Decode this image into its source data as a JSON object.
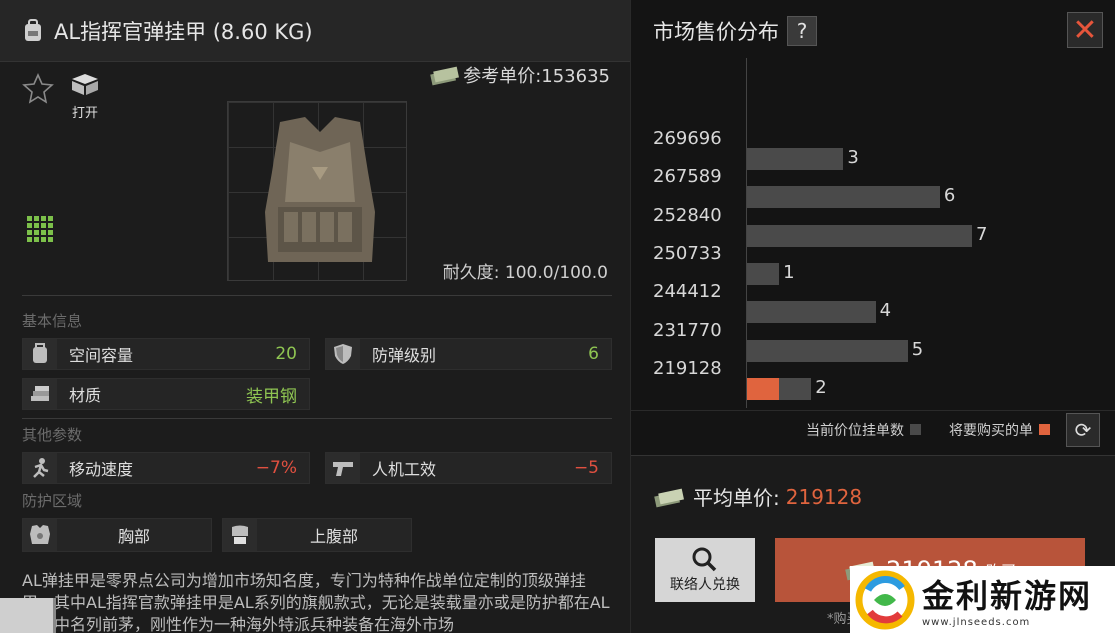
{
  "item": {
    "title": "AL指挥官弹挂甲 (8.60 KG)",
    "open_label": "打开",
    "ref_price_label": "参考单价:153635",
    "durability": "耐久度: 100.0/100.0"
  },
  "basic_info": {
    "section_label": "基本信息",
    "capacity_label": "空间容量",
    "capacity_value": "20",
    "armor_class_label": "防弹级别",
    "armor_class_value": "6",
    "material_label": "材质",
    "material_value": "装甲钢"
  },
  "other_params": {
    "section_label": "其他参数",
    "move_speed_label": "移动速度",
    "move_speed_value": "−7%",
    "ergonomics_label": "人机工效",
    "ergonomics_value": "−5"
  },
  "protection": {
    "section_label": "防护区域",
    "zones": [
      "胸部",
      "上腹部"
    ]
  },
  "description": "AL弹挂甲是零界点公司为增加市场知名度，专门为特种作战单位定制的顶级弹挂甲。其中AL指挥官款弹挂甲是AL系列的旗舰款式，无论是装载量亦或是防护都在AL系列中名列前茅，刚性作为一种海外特派兵种装备在海外市场",
  "market": {
    "title": "市场售价分布",
    "help_label": "?",
    "close_label": "✕",
    "legend_current": "当前价位挂单数",
    "legend_buy": "将要购买的单",
    "refresh_label": "⟳",
    "avg_label": "平均单价:",
    "avg_value": "219128",
    "contact_label": "联络人兑换",
    "buy_price": "219128",
    "buy_label": "购买",
    "buy_note": "*购买"
  },
  "chart_data": {
    "type": "bar",
    "orientation": "horizontal",
    "price_ticks": [
      "269696",
      "267589",
      "252840",
      "250733",
      "244412",
      "231770",
      "219128"
    ],
    "counts": [
      3,
      6,
      7,
      1,
      4,
      5,
      2
    ],
    "buy_counts": [
      0,
      0,
      0,
      0,
      0,
      0,
      1
    ],
    "colors": {
      "current": "#4a4a4a",
      "buy": "#e0643e"
    }
  },
  "watermark": {
    "name": "金利新游网",
    "url": "www.jlnseeds.com"
  }
}
